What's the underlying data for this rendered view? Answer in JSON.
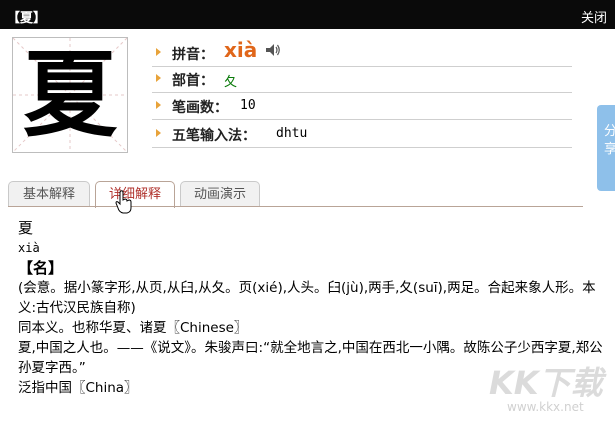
{
  "window": {
    "title": "【夏】",
    "close_label": "关闭"
  },
  "character": {
    "glyph": "夏"
  },
  "info": {
    "pinyin_label": "拼音：",
    "pinyin_value": "xià",
    "radical_label": "部首：",
    "radical_value": "夂",
    "strokes_label": "笔画数：",
    "strokes_value": "10",
    "wubi_label": "五笔输入法：",
    "wubi_value": "dhtu"
  },
  "tabs": [
    {
      "label": "基本解释"
    },
    {
      "label": "详细解释"
    },
    {
      "label": "动画演示"
    }
  ],
  "content": {
    "char": "夏",
    "pinyin": "xià",
    "section": "【名】",
    "lines": [
      "(会意。据小篆字形,从页,从臼,从夂。页(xié),人头。臼(jù),两手,夂(suī),两足。合起来象人形。本义:古代汉民族自称)",
      "同本义。也称华夏、诸夏〖Chinese〗",
      "夏,中国之人也。——《说文》。朱骏声曰:“就全地言之,中国在西北一小隅。故陈公子少西字夏,郑公孙夏字西。”",
      "泛指中国〖China〗"
    ]
  },
  "side_tab": {
    "label": "分享"
  },
  "watermark": {
    "brand": "KK下载",
    "url": "www.kkx.net"
  },
  "colors": {
    "titlebar": "#0a0a0a",
    "pinyin": "#e0661a",
    "radical": "#0a7a0a",
    "active_tab_text": "#b0322c",
    "side_tab": "#8ec0ea",
    "arrow": "#e8a33a"
  }
}
